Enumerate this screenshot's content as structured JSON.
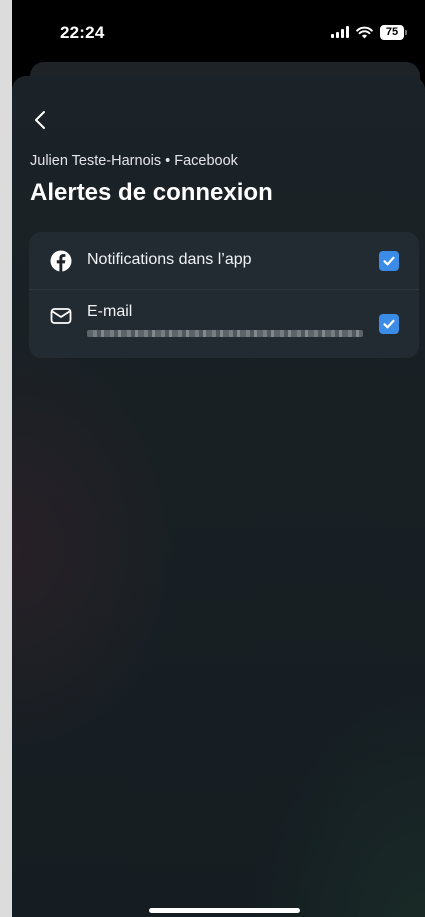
{
  "status_bar": {
    "time": "22:24",
    "battery": "75"
  },
  "header": {
    "subtitle": "Julien Teste-Harnois • Facebook",
    "title": "Alertes de connexion"
  },
  "options": [
    {
      "label": "Notifications dans l’app",
      "icon": "facebook-icon",
      "checked": true
    },
    {
      "label": "E-mail",
      "icon": "mail-icon",
      "checked": true
    }
  ],
  "colors": {
    "accent": "#3b8ce6",
    "card": "#222b31",
    "background": "#182024"
  }
}
